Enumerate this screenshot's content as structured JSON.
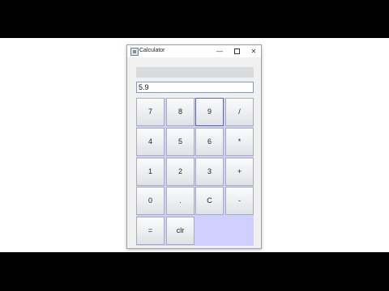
{
  "window": {
    "title": "Calculator",
    "controls": {
      "minimize": "—",
      "close": "✕"
    },
    "icon": "calculator-app-icon"
  },
  "display": {
    "value": "5.9"
  },
  "keys": [
    {
      "label": "7",
      "name": "key-7"
    },
    {
      "label": "8",
      "name": "key-8"
    },
    {
      "label": "9",
      "name": "key-9",
      "focused": true
    },
    {
      "label": "/",
      "name": "key-divide"
    },
    {
      "label": "4",
      "name": "key-4"
    },
    {
      "label": "5",
      "name": "key-5"
    },
    {
      "label": "6",
      "name": "key-6"
    },
    {
      "label": "*",
      "name": "key-multiply"
    },
    {
      "label": "1",
      "name": "key-1"
    },
    {
      "label": "2",
      "name": "key-2"
    },
    {
      "label": "3",
      "name": "key-3"
    },
    {
      "label": "+",
      "name": "key-plus"
    },
    {
      "label": "0",
      "name": "key-0"
    },
    {
      "label": ".",
      "name": "key-decimal"
    },
    {
      "label": "C",
      "name": "key-clear-entry"
    },
    {
      "label": "-",
      "name": "key-minus"
    },
    {
      "label": "=",
      "name": "key-equals"
    },
    {
      "label": "clr",
      "name": "key-clear-all"
    }
  ],
  "colors": {
    "keypad_background": "#cfd0ff",
    "window_background": "#f0f0f0"
  }
}
